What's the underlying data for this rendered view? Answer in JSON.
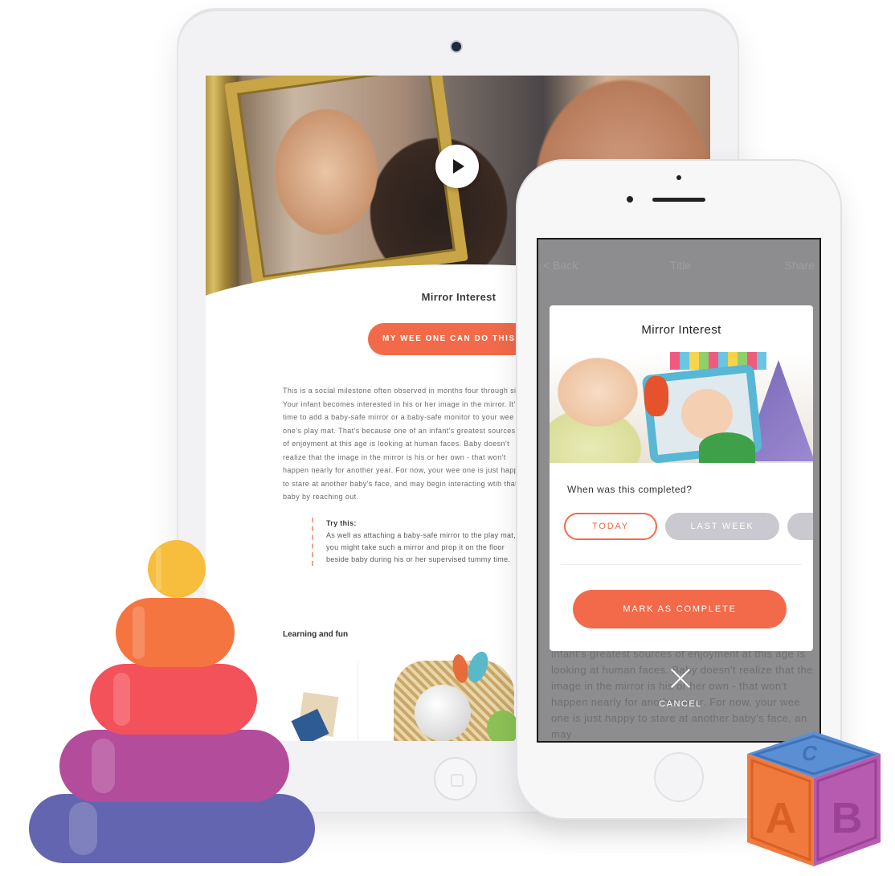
{
  "tablet": {
    "article_title": "Mirror Interest",
    "cta_label": "MY WEE ONE CAN DO THIS",
    "body_text": "This is a social milestone often observed in months four through six. Your infant becomes interested in his or her image in the mirror. It's time to add a baby-safe mirror or a baby-safe monitor to your wee one's play mat. That's because one of an infant's greatest sources of enjoyment at this age is looking at human faces. Baby doesn't realize that the image in the mirror is his or her own - that won't happen nearly for another year. For now, your wee one is just happy to stare at another baby's face, and may begin interacting wtih that baby by reaching out.",
    "try_heading": "Try this:",
    "try_text": "As well as attaching a baby-safe mirror to the play mat, you might take such a mirror and prop it on the floor beside baby during his or her supervised tummy time.",
    "section_heading": "Learning and fun"
  },
  "phone": {
    "nav": {
      "back_label": "< Back",
      "title": "Title",
      "share_label": "Share"
    },
    "background_text": "infant's greatest sources of enjoyment at this age is looking at human faces. Baby doesn't realize that the image in the mirror is his or her own - that won't happen nearly for another year. For now, your wee one is just happy to stare at another baby's face, an may",
    "modal": {
      "title": "Mirror Interest",
      "question": "When was this completed?",
      "options": [
        "TODAY",
        "LAST WEEK",
        ""
      ],
      "selected_option": "TODAY",
      "complete_button": "MARK AS COMPLETE"
    },
    "cancel_label": "CANCEL"
  },
  "decor": {
    "block_letters": [
      "A",
      "B",
      "C"
    ]
  },
  "colors": {
    "accent": "#f26a4a",
    "chip_inactive": "#c9c9cf",
    "overlay": "#8d8d8f"
  }
}
